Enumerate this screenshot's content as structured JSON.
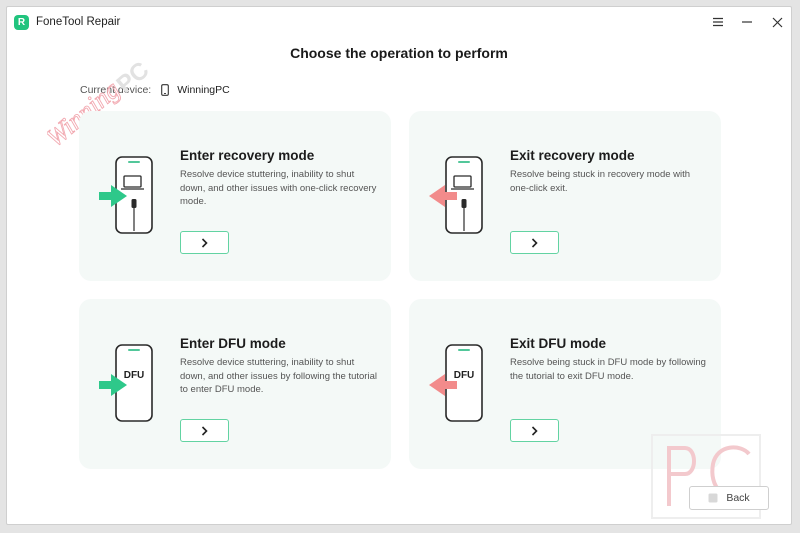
{
  "window": {
    "title": "FoneTool Repair"
  },
  "header": {
    "title": "Choose the operation to perform"
  },
  "device": {
    "label": "Current device:",
    "name": "WinningPC"
  },
  "cards": [
    {
      "title": "Enter recovery mode",
      "description": "Resolve device stuttering, inability to shut down, and other issues with one-click recovery mode.",
      "icon": "laptop-icon",
      "arrow": "green-enter"
    },
    {
      "title": "Exit recovery mode",
      "description": "Resolve being stuck in recovery mode with one-click exit.",
      "icon": "laptop-icon",
      "arrow": "red-exit"
    },
    {
      "title": "Enter DFU mode",
      "description": "Resolve device stuttering, inability to shut down, and other issues by following the tutorial to enter DFU mode.",
      "icon": "dfu-text",
      "icon_text": "DFU",
      "arrow": "green-enter"
    },
    {
      "title": "Exit DFU mode",
      "description": "Resolve being stuck in DFU mode by following the tutorial to exit DFU mode.",
      "icon": "dfu-text",
      "icon_text": "DFU",
      "arrow": "red-exit"
    }
  ],
  "footer": {
    "back_label": "Back"
  },
  "watermarks": {
    "winning": "Winning",
    "pc": "PC"
  },
  "colors": {
    "accent": "#21c47e",
    "exit_arrow": "#f28b8b",
    "card_bg": "#f4f9f7"
  }
}
